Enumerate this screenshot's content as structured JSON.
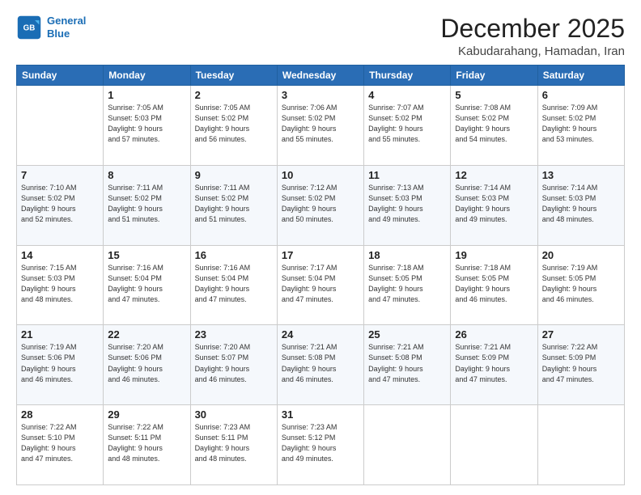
{
  "header": {
    "logo_line1": "General",
    "logo_line2": "Blue",
    "title": "December 2025",
    "subtitle": "Kabudarahang, Hamadan, Iran"
  },
  "weekdays": [
    "Sunday",
    "Monday",
    "Tuesday",
    "Wednesday",
    "Thursday",
    "Friday",
    "Saturday"
  ],
  "weeks": [
    [
      {
        "day": "",
        "info": ""
      },
      {
        "day": "1",
        "info": "Sunrise: 7:05 AM\nSunset: 5:03 PM\nDaylight: 9 hours\nand 57 minutes."
      },
      {
        "day": "2",
        "info": "Sunrise: 7:05 AM\nSunset: 5:02 PM\nDaylight: 9 hours\nand 56 minutes."
      },
      {
        "day": "3",
        "info": "Sunrise: 7:06 AM\nSunset: 5:02 PM\nDaylight: 9 hours\nand 55 minutes."
      },
      {
        "day": "4",
        "info": "Sunrise: 7:07 AM\nSunset: 5:02 PM\nDaylight: 9 hours\nand 55 minutes."
      },
      {
        "day": "5",
        "info": "Sunrise: 7:08 AM\nSunset: 5:02 PM\nDaylight: 9 hours\nand 54 minutes."
      },
      {
        "day": "6",
        "info": "Sunrise: 7:09 AM\nSunset: 5:02 PM\nDaylight: 9 hours\nand 53 minutes."
      }
    ],
    [
      {
        "day": "7",
        "info": "Sunrise: 7:10 AM\nSunset: 5:02 PM\nDaylight: 9 hours\nand 52 minutes."
      },
      {
        "day": "8",
        "info": "Sunrise: 7:11 AM\nSunset: 5:02 PM\nDaylight: 9 hours\nand 51 minutes."
      },
      {
        "day": "9",
        "info": "Sunrise: 7:11 AM\nSunset: 5:02 PM\nDaylight: 9 hours\nand 51 minutes."
      },
      {
        "day": "10",
        "info": "Sunrise: 7:12 AM\nSunset: 5:02 PM\nDaylight: 9 hours\nand 50 minutes."
      },
      {
        "day": "11",
        "info": "Sunrise: 7:13 AM\nSunset: 5:03 PM\nDaylight: 9 hours\nand 49 minutes."
      },
      {
        "day": "12",
        "info": "Sunrise: 7:14 AM\nSunset: 5:03 PM\nDaylight: 9 hours\nand 49 minutes."
      },
      {
        "day": "13",
        "info": "Sunrise: 7:14 AM\nSunset: 5:03 PM\nDaylight: 9 hours\nand 48 minutes."
      }
    ],
    [
      {
        "day": "14",
        "info": "Sunrise: 7:15 AM\nSunset: 5:03 PM\nDaylight: 9 hours\nand 48 minutes."
      },
      {
        "day": "15",
        "info": "Sunrise: 7:16 AM\nSunset: 5:04 PM\nDaylight: 9 hours\nand 47 minutes."
      },
      {
        "day": "16",
        "info": "Sunrise: 7:16 AM\nSunset: 5:04 PM\nDaylight: 9 hours\nand 47 minutes."
      },
      {
        "day": "17",
        "info": "Sunrise: 7:17 AM\nSunset: 5:04 PM\nDaylight: 9 hours\nand 47 minutes."
      },
      {
        "day": "18",
        "info": "Sunrise: 7:18 AM\nSunset: 5:05 PM\nDaylight: 9 hours\nand 47 minutes."
      },
      {
        "day": "19",
        "info": "Sunrise: 7:18 AM\nSunset: 5:05 PM\nDaylight: 9 hours\nand 46 minutes."
      },
      {
        "day": "20",
        "info": "Sunrise: 7:19 AM\nSunset: 5:05 PM\nDaylight: 9 hours\nand 46 minutes."
      }
    ],
    [
      {
        "day": "21",
        "info": "Sunrise: 7:19 AM\nSunset: 5:06 PM\nDaylight: 9 hours\nand 46 minutes."
      },
      {
        "day": "22",
        "info": "Sunrise: 7:20 AM\nSunset: 5:06 PM\nDaylight: 9 hours\nand 46 minutes."
      },
      {
        "day": "23",
        "info": "Sunrise: 7:20 AM\nSunset: 5:07 PM\nDaylight: 9 hours\nand 46 minutes."
      },
      {
        "day": "24",
        "info": "Sunrise: 7:21 AM\nSunset: 5:08 PM\nDaylight: 9 hours\nand 46 minutes."
      },
      {
        "day": "25",
        "info": "Sunrise: 7:21 AM\nSunset: 5:08 PM\nDaylight: 9 hours\nand 47 minutes."
      },
      {
        "day": "26",
        "info": "Sunrise: 7:21 AM\nSunset: 5:09 PM\nDaylight: 9 hours\nand 47 minutes."
      },
      {
        "day": "27",
        "info": "Sunrise: 7:22 AM\nSunset: 5:09 PM\nDaylight: 9 hours\nand 47 minutes."
      }
    ],
    [
      {
        "day": "28",
        "info": "Sunrise: 7:22 AM\nSunset: 5:10 PM\nDaylight: 9 hours\nand 47 minutes."
      },
      {
        "day": "29",
        "info": "Sunrise: 7:22 AM\nSunset: 5:11 PM\nDaylight: 9 hours\nand 48 minutes."
      },
      {
        "day": "30",
        "info": "Sunrise: 7:23 AM\nSunset: 5:11 PM\nDaylight: 9 hours\nand 48 minutes."
      },
      {
        "day": "31",
        "info": "Sunrise: 7:23 AM\nSunset: 5:12 PM\nDaylight: 9 hours\nand 49 minutes."
      },
      {
        "day": "",
        "info": ""
      },
      {
        "day": "",
        "info": ""
      },
      {
        "day": "",
        "info": ""
      }
    ]
  ]
}
